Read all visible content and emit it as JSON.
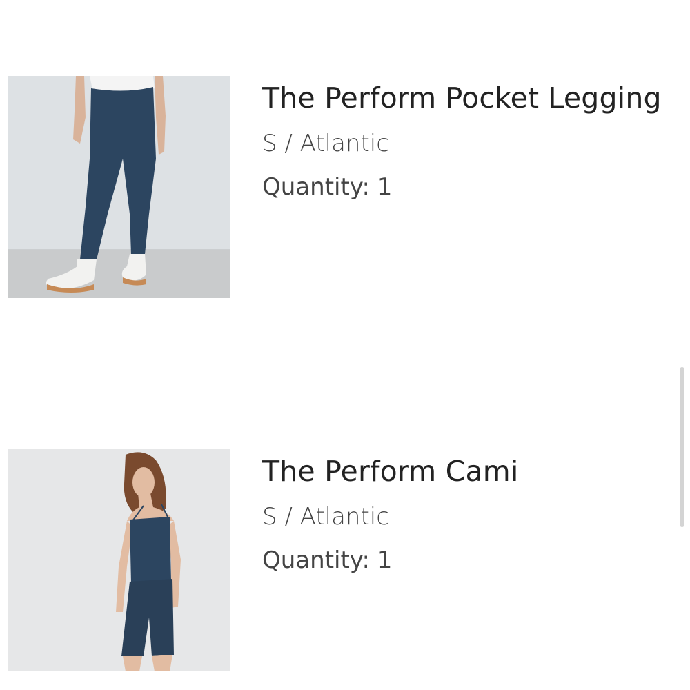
{
  "cart": {
    "items": [
      {
        "title": "The Perform Pocket Legging",
        "variant": "S / Atlantic",
        "quantity_label": "Quantity:",
        "quantity": "1",
        "image": "model-wearing-navy-leggings"
      },
      {
        "title": "The Perform Cami",
        "variant": "S / Atlantic",
        "quantity_label": "Quantity:",
        "quantity": "1",
        "image": "model-wearing-navy-cami-and-shorts"
      }
    ]
  },
  "colors": {
    "product_navy": "#2c4560",
    "background": "#ffffff",
    "text_primary": "#222222",
    "text_secondary": "#444444"
  }
}
